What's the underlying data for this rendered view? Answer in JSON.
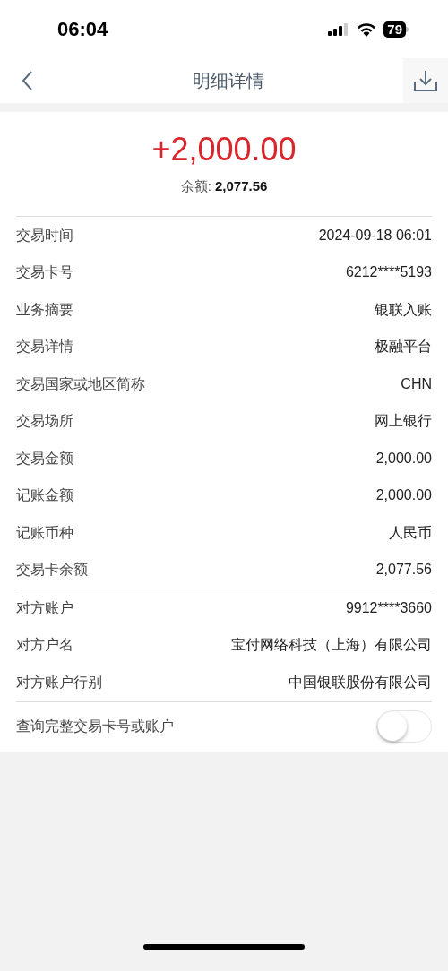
{
  "status_bar": {
    "time": "06:04",
    "battery": "79"
  },
  "nav": {
    "title": "明细详情"
  },
  "summary": {
    "amount": "+2,000.00",
    "balance": "余额: **2,077.56**"
  },
  "groups": [
    {
      "rows": [
        {
          "label": "交易时间",
          "value": "2024-09-18 06:01"
        },
        {
          "label": "交易卡号",
          "value": "6212****5193"
        },
        {
          "label": "业务摘要",
          "value": "银联入账"
        },
        {
          "label": "交易详情",
          "value": "极融平台"
        },
        {
          "label": "交易国家或地区简称",
          "value": "CHN"
        },
        {
          "label": "交易场所",
          "value": "网上银行"
        },
        {
          "label": "交易金额",
          "value": "2,000.00"
        },
        {
          "label": "记账金额",
          "value": "2,000.00"
        },
        {
          "label": "记账币种",
          "value": "人民币"
        },
        {
          "label": "交易卡余额",
          "value": "2,077.56"
        }
      ]
    },
    {
      "rows": [
        {
          "label": "对方账户",
          "value": "9912****3660"
        },
        {
          "label": "对方户名",
          "value": "宝付网络科技（上海）有限公司"
        },
        {
          "label": "对方账户行别",
          "value": "中国银联股份有限公司"
        }
      ]
    }
  ],
  "toggle": {
    "label": "查询完整交易卡号或账户",
    "on": false
  }
}
